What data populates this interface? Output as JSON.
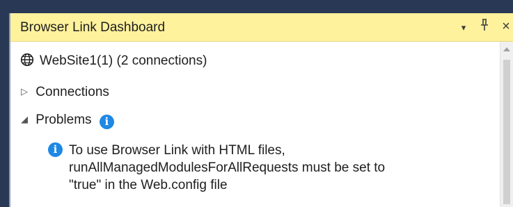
{
  "window": {
    "title": "Browser Link Dashboard",
    "dropdown_glyph": "▾",
    "pin_glyph": "ꟼ",
    "close_glyph": "×"
  },
  "tree": {
    "site": {
      "label": "WebSite1(1) (2 connections)",
      "icon": "globe-icon"
    },
    "connections": {
      "label": "Connections",
      "expander": "▷",
      "state": "collapsed"
    },
    "problems": {
      "label": "Problems",
      "expander": "◢",
      "state": "expanded",
      "icon": "info-icon"
    },
    "message": {
      "icon": "info-icon",
      "lines": [
        "To use Browser Link with HTML files,",
        "runAllManagedModulesForAllRequests must be set to",
        "\"true\" in the Web.config file"
      ]
    }
  },
  "colors": {
    "title_bar": "#fff29d",
    "background": "#293955",
    "info": "#1e88e5"
  }
}
